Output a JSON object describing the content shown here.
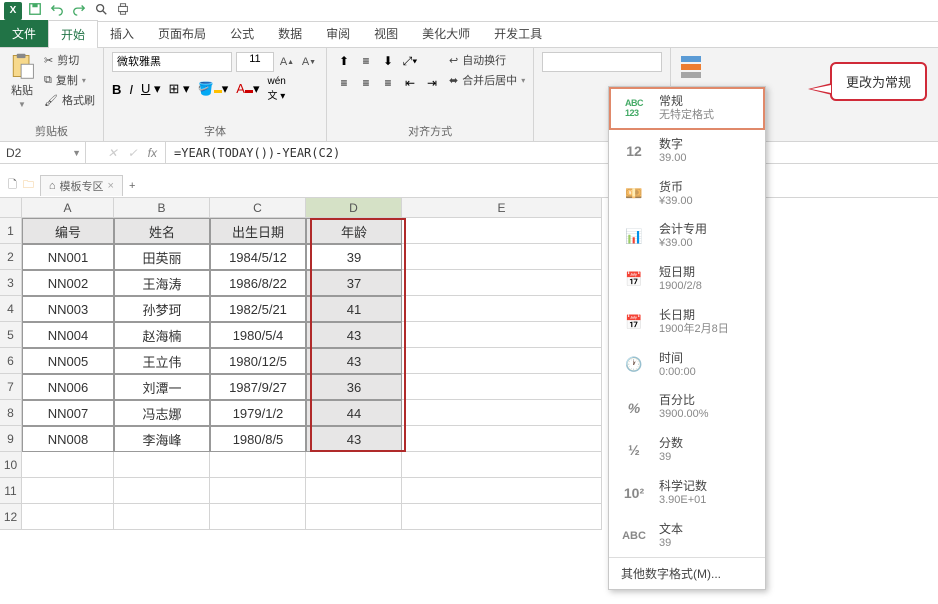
{
  "tabs": {
    "file": "文件",
    "home": "开始",
    "insert": "插入",
    "layout": "页面布局",
    "formulas": "公式",
    "data": "数据",
    "review": "审阅",
    "view": "视图",
    "beautify": "美化大师",
    "dev": "开发工具"
  },
  "ribbon": {
    "clipboard": {
      "paste": "粘贴",
      "cut": "剪切",
      "copy": "复制",
      "painter": "格式刷",
      "label": "剪贴板"
    },
    "font": {
      "name": "微软雅黑",
      "size": "11",
      "label": "字体"
    },
    "align": {
      "wrap": "自动换行",
      "merge": "合并后居中",
      "label": "对齐方式"
    }
  },
  "callout": "更改为常规",
  "namebox": "D2",
  "formula": "=YEAR(TODAY())-YEAR(C2)",
  "sheettab": "模板专区",
  "columns": {
    "A": "A",
    "B": "B",
    "C": "C",
    "D": "D",
    "E": "E"
  },
  "headers": {
    "id": "编号",
    "name": "姓名",
    "dob": "出生日期",
    "age": "年龄"
  },
  "rows": [
    {
      "id": "NN001",
      "name": "田英丽",
      "dob": "1984/5/12",
      "age": "39"
    },
    {
      "id": "NN002",
      "name": "王海涛",
      "dob": "1986/8/22",
      "age": "37"
    },
    {
      "id": "NN003",
      "name": "孙梦珂",
      "dob": "1982/5/21",
      "age": "41"
    },
    {
      "id": "NN004",
      "name": "赵海楠",
      "dob": "1980/5/4",
      "age": "43"
    },
    {
      "id": "NN005",
      "name": "王立伟",
      "dob": "1980/12/5",
      "age": "43"
    },
    {
      "id": "NN006",
      "name": "刘潭一",
      "dob": "1987/9/27",
      "age": "36"
    },
    {
      "id": "NN007",
      "name": "冯志娜",
      "dob": "1979/1/2",
      "age": "44"
    },
    {
      "id": "NN008",
      "name": "李海峰",
      "dob": "1980/8/5",
      "age": "43"
    }
  ],
  "numberFormats": {
    "general": {
      "title": "常规",
      "sample": "无特定格式"
    },
    "number": {
      "title": "数字",
      "sample": "39.00"
    },
    "currency": {
      "title": "货币",
      "sample": "¥39.00"
    },
    "accounting": {
      "title": "会计专用",
      "sample": "¥39.00"
    },
    "shortdate": {
      "title": "短日期",
      "sample": "1900/2/8"
    },
    "longdate": {
      "title": "长日期",
      "sample": "1900年2月8日"
    },
    "time": {
      "title": "时间",
      "sample": "0:00:00"
    },
    "percent": {
      "title": "百分比",
      "sample": "3900.00%"
    },
    "fraction": {
      "title": "分数",
      "sample": "39"
    },
    "sci": {
      "title": "科学记数",
      "sample": "3.90E+01"
    },
    "text": {
      "title": "文本",
      "sample": "39"
    },
    "more": "其他数字格式(M)..."
  }
}
